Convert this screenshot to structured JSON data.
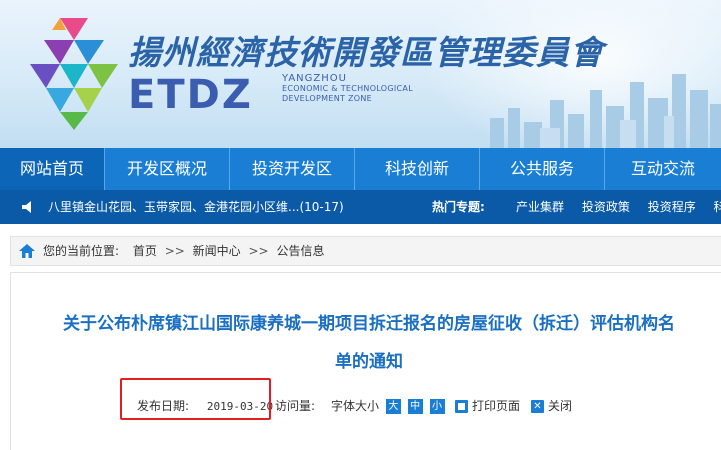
{
  "header": {
    "org_name_cn": "揚州經濟技術開發區管理委員會",
    "logo_abbr": "ETDZ",
    "logo_en_lines": [
      "YANGZHOU",
      "ECONOMIC & TECHNOLOGICAL",
      "DEVELOPMENT ZONE"
    ]
  },
  "nav": {
    "items": [
      {
        "label": "网站首页",
        "active": true
      },
      {
        "label": "开发区概况"
      },
      {
        "label": "投资开发区"
      },
      {
        "label": "科技创新"
      },
      {
        "label": "公共服务"
      },
      {
        "label": "互动交流"
      }
    ]
  },
  "ticker": {
    "news": "八里镇金山花园、玉带家园、金港花园小区维...(10-17)",
    "hot_label": "热门专题:",
    "hot_links": [
      "产业集群",
      "投资政策",
      "投资程序",
      "科"
    ]
  },
  "breadcrumb": {
    "prefix": "您的当前位置:",
    "items": [
      "首页",
      "新闻中心",
      "公告信息"
    ],
    "separator": ">>"
  },
  "article": {
    "title_line1": "关于公布朴席镇江山国际康养城一期项目拆迁报名的房屋征收（拆迁）评估机构名",
    "title_line2": "单的通知",
    "publish_label": "发布日期:",
    "publish_date": "2019-03-20",
    "visits_label": "访问量:",
    "font_size_label": "字体大小",
    "font_buttons": [
      "大",
      "中",
      "小"
    ],
    "print_label": "打印页面",
    "close_label": "关闭"
  },
  "colors": {
    "nav_bg": "#1a7fd4",
    "nav_active": "#0d65b8",
    "ticker_bg": "#0a5aa8",
    "title": "#1a6fc2",
    "highlight": "#e02020"
  }
}
